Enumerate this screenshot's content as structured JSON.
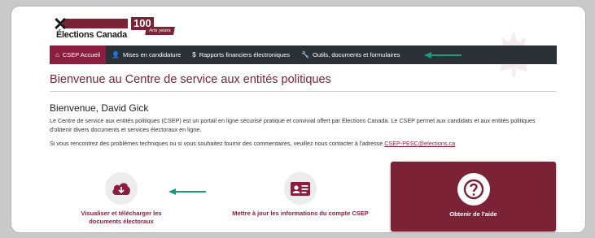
{
  "header": {
    "logo_text": "Élections Canada",
    "anniversary_number": "100",
    "anniversary_word": "Ans years"
  },
  "nav": {
    "items": [
      {
        "label": "CSEP Accueil",
        "icon": "home-icon"
      },
      {
        "label": "Mises en candidature",
        "icon": "user-icon"
      },
      {
        "label": "Rapports financiers électroniques",
        "icon": "dollar-icon"
      },
      {
        "label": "Outils, documents et formulaires",
        "icon": "wrench-icon"
      }
    ]
  },
  "main": {
    "title": "Bienvenue au Centre de service aux entités politiques",
    "greeting": "Bienvenue, David Gick",
    "intro": "Le Centre de service aux entités politiques (CSEP) est un portail en ligne sécurisé pratique et convivial offert par Élections Canada. Le CSEP permet aux candidats et aux entités politiques d'obtenir divers documents et services électoraux en ligne.",
    "contact_text": "Si vous rencontrez des problèmes techniques ou si vous souhaitez fournir des commentaires, veuillez nous contacter à l'adresse",
    "contact_email": "CSEP-PESC@elections.ca"
  },
  "cards": {
    "download": "Visualiser et télécharger les documents électoraux",
    "update": "Mettre à jour les informations du compte CSEP",
    "help": "Obtenir de l'aide"
  },
  "colors": {
    "brand": "#7b2236",
    "nav_bg": "#2b3036",
    "annotation_arrow": "#1a9a7e"
  }
}
